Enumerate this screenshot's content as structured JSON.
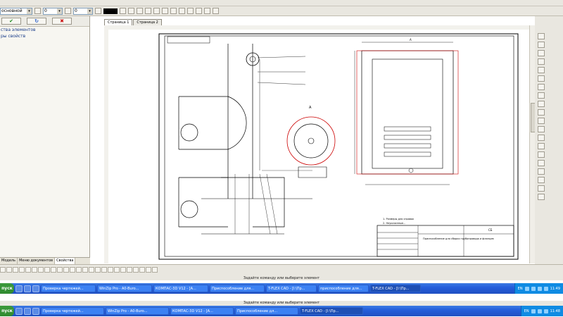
{
  "toolbar": {
    "style_combo": "основной",
    "combo2": "0",
    "combo3": "0"
  },
  "left_panel": {
    "line1": "ства элементов",
    "line2": "ры свойств",
    "tabs": [
      "Модель",
      "Меню документов",
      "Свойства"
    ]
  },
  "doc_tabs": [
    "Страница 1",
    "Страница 2"
  ],
  "drawing": {
    "view_label": "А",
    "sheet_title": "Приспособление для сборки трубопровода и фланцев",
    "sheet_code": "СБ",
    "notes": [
      "1. Размеры для справок",
      "2. Неуказанные..."
    ]
  },
  "status": {
    "message": "Задайте команду или выберите элемент",
    "message2": "Задайте команду или выберите элемент"
  },
  "taskbar1": {
    "start": "пуск",
    "tasks": [
      "Проверка чертежей...",
      "WinZip Pro - A0-Buro...",
      "КОМПАС-3D V12 - [А...",
      "Приспособление для...",
      "T-FLEX CAD - [I:\\Пр...",
      "приспособление для...",
      "T-FLEX CAD - [I:\\Пр..."
    ],
    "lang": "EN",
    "clock": "11:49"
  },
  "taskbar2": {
    "start": "пуск",
    "tasks": [
      "Проверка чертежей...",
      "WinZip Pro - A0-Buro...",
      "КОМПАС-3D V12 - [А...",
      "Приспособление дл...",
      "T-FLEX CAD - [I:\\Пр..."
    ],
    "lang": "EN",
    "clock": "11:48"
  },
  "colors": {
    "taskbar": "#245edb",
    "red_line": "#cc0000",
    "canvas": "#ffffff"
  }
}
